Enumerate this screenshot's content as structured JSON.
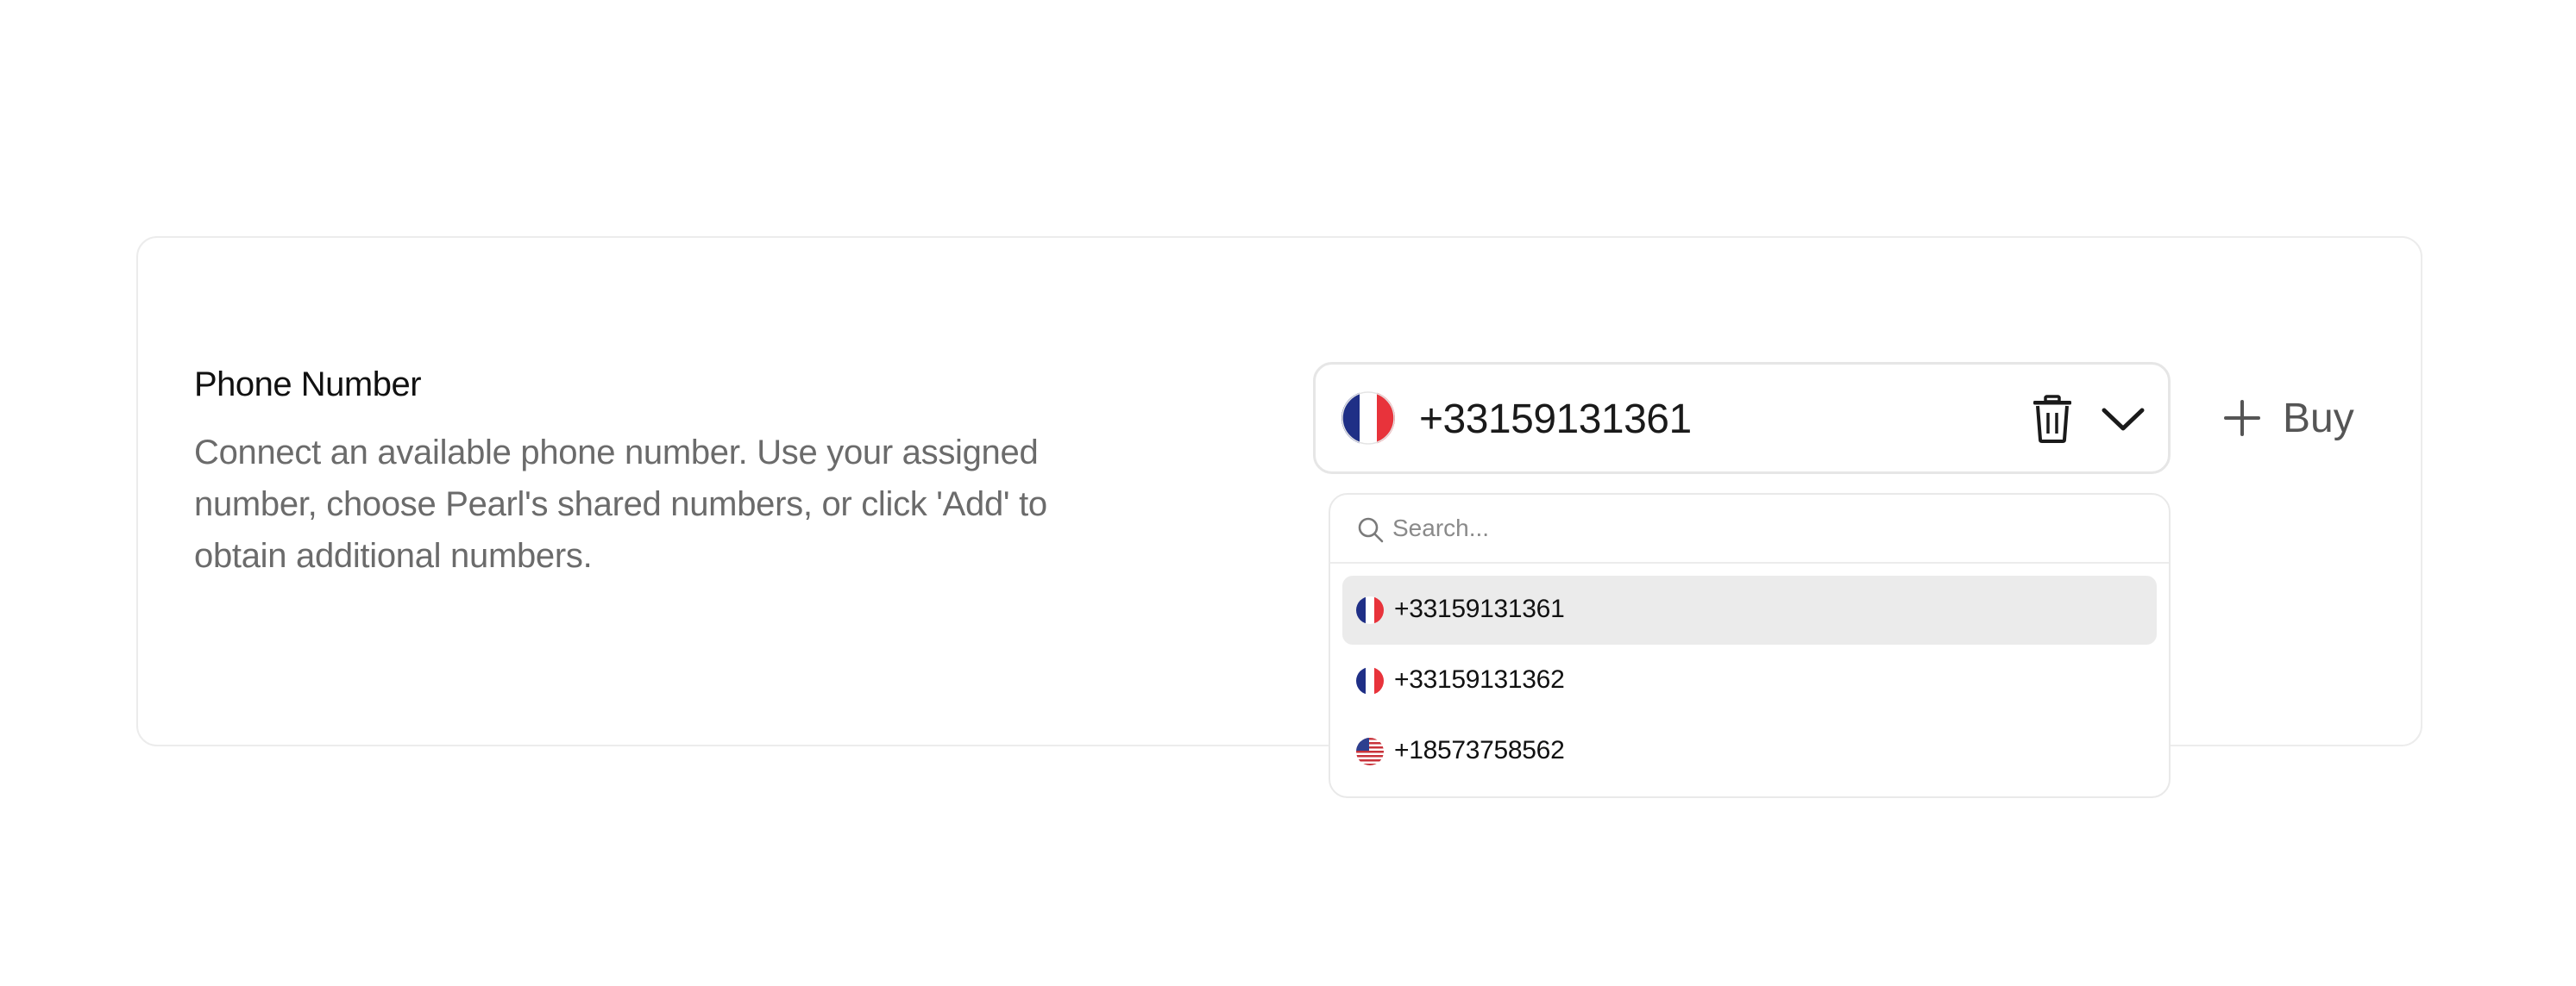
{
  "section": {
    "title": "Phone Number",
    "description": "Connect an available phone number. Use your assigned number, choose Pearl's shared numbers, or click 'Add' to obtain additional numbers."
  },
  "phone_select": {
    "selected_value": "+33159131361",
    "selected_flag": "flag-france-icon",
    "delete_icon": "trash-icon",
    "toggle_icon": "chevron-down-icon"
  },
  "buy_button": {
    "icon": "plus-icon",
    "label": "Buy"
  },
  "dropdown": {
    "search_placeholder": "Search...",
    "search_value": "",
    "options": [
      {
        "label": "+33159131361",
        "flag": "flag-france-icon",
        "selected": true
      },
      {
        "label": "+33159131362",
        "flag": "flag-france-icon",
        "selected": false
      },
      {
        "label": "+18573758562",
        "flag": "flag-usa-icon",
        "selected": false
      }
    ]
  },
  "colors": {
    "border": "#ececec",
    "description_text": "#6b6b6b",
    "selected_option_bg": "#ebebeb",
    "france_blue": "#1f2f86",
    "france_red": "#e8333b",
    "usa_red": "#c8323a",
    "usa_blue": "#2d3f8f"
  }
}
